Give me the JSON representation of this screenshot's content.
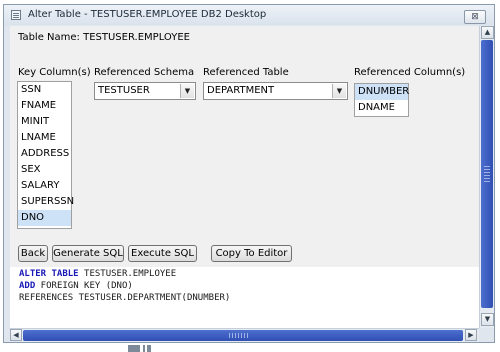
{
  "window": {
    "title": "Alter Table - TESTUSER.EMPLOYEE DB2 Desktop",
    "close_symbol": "⊠"
  },
  "table_name": "Table Name: TESTUSER.EMPLOYEE",
  "labels": {
    "key_columns": "Key Column(s)",
    "referenced_schema": "Referenced Schema",
    "referenced_table": "Referenced Table",
    "referenced_columns": "Referenced Column(s)"
  },
  "key_columns": [
    "SSN",
    "FNAME",
    "MINIT",
    "LNAME",
    "ADDRESS",
    "SEX",
    "SALARY",
    "SUPERSSN",
    "DNO"
  ],
  "key_columns_selected": "DNO",
  "referenced_schema": {
    "value": "TESTUSER"
  },
  "referenced_table": {
    "value": "DEPARTMENT"
  },
  "referenced_columns": [
    "DNUMBER",
    "DNAME"
  ],
  "referenced_columns_selected": "DNUMBER",
  "buttons": {
    "back": "Back",
    "generate_sql": "Generate SQL",
    "execute_sql": "Execute SQL",
    "copy_to_editor": "Copy To Editor"
  },
  "sql": {
    "line1_kw": "ALTER TABLE",
    "line1_rest": " TESTUSER.EMPLOYEE",
    "line2_kw": "ADD",
    "line2_rest": " FOREIGN KEY (DNO)",
    "line3": "REFERENCES TESTUSER.DEPARTMENT(DNUMBER)"
  },
  "colors": {
    "selection": "#cde1f7",
    "scrollbar_thumb": "#2f4fb2",
    "sql_keyword": "#1a1ab8"
  },
  "icons": [
    "window-menu-icon",
    "close-icon",
    "dropdown-arrow-icon",
    "scroll-up-arrow-icon",
    "scroll-down-arrow-icon",
    "scroll-left-arrow-icon",
    "scroll-right-arrow-icon"
  ]
}
